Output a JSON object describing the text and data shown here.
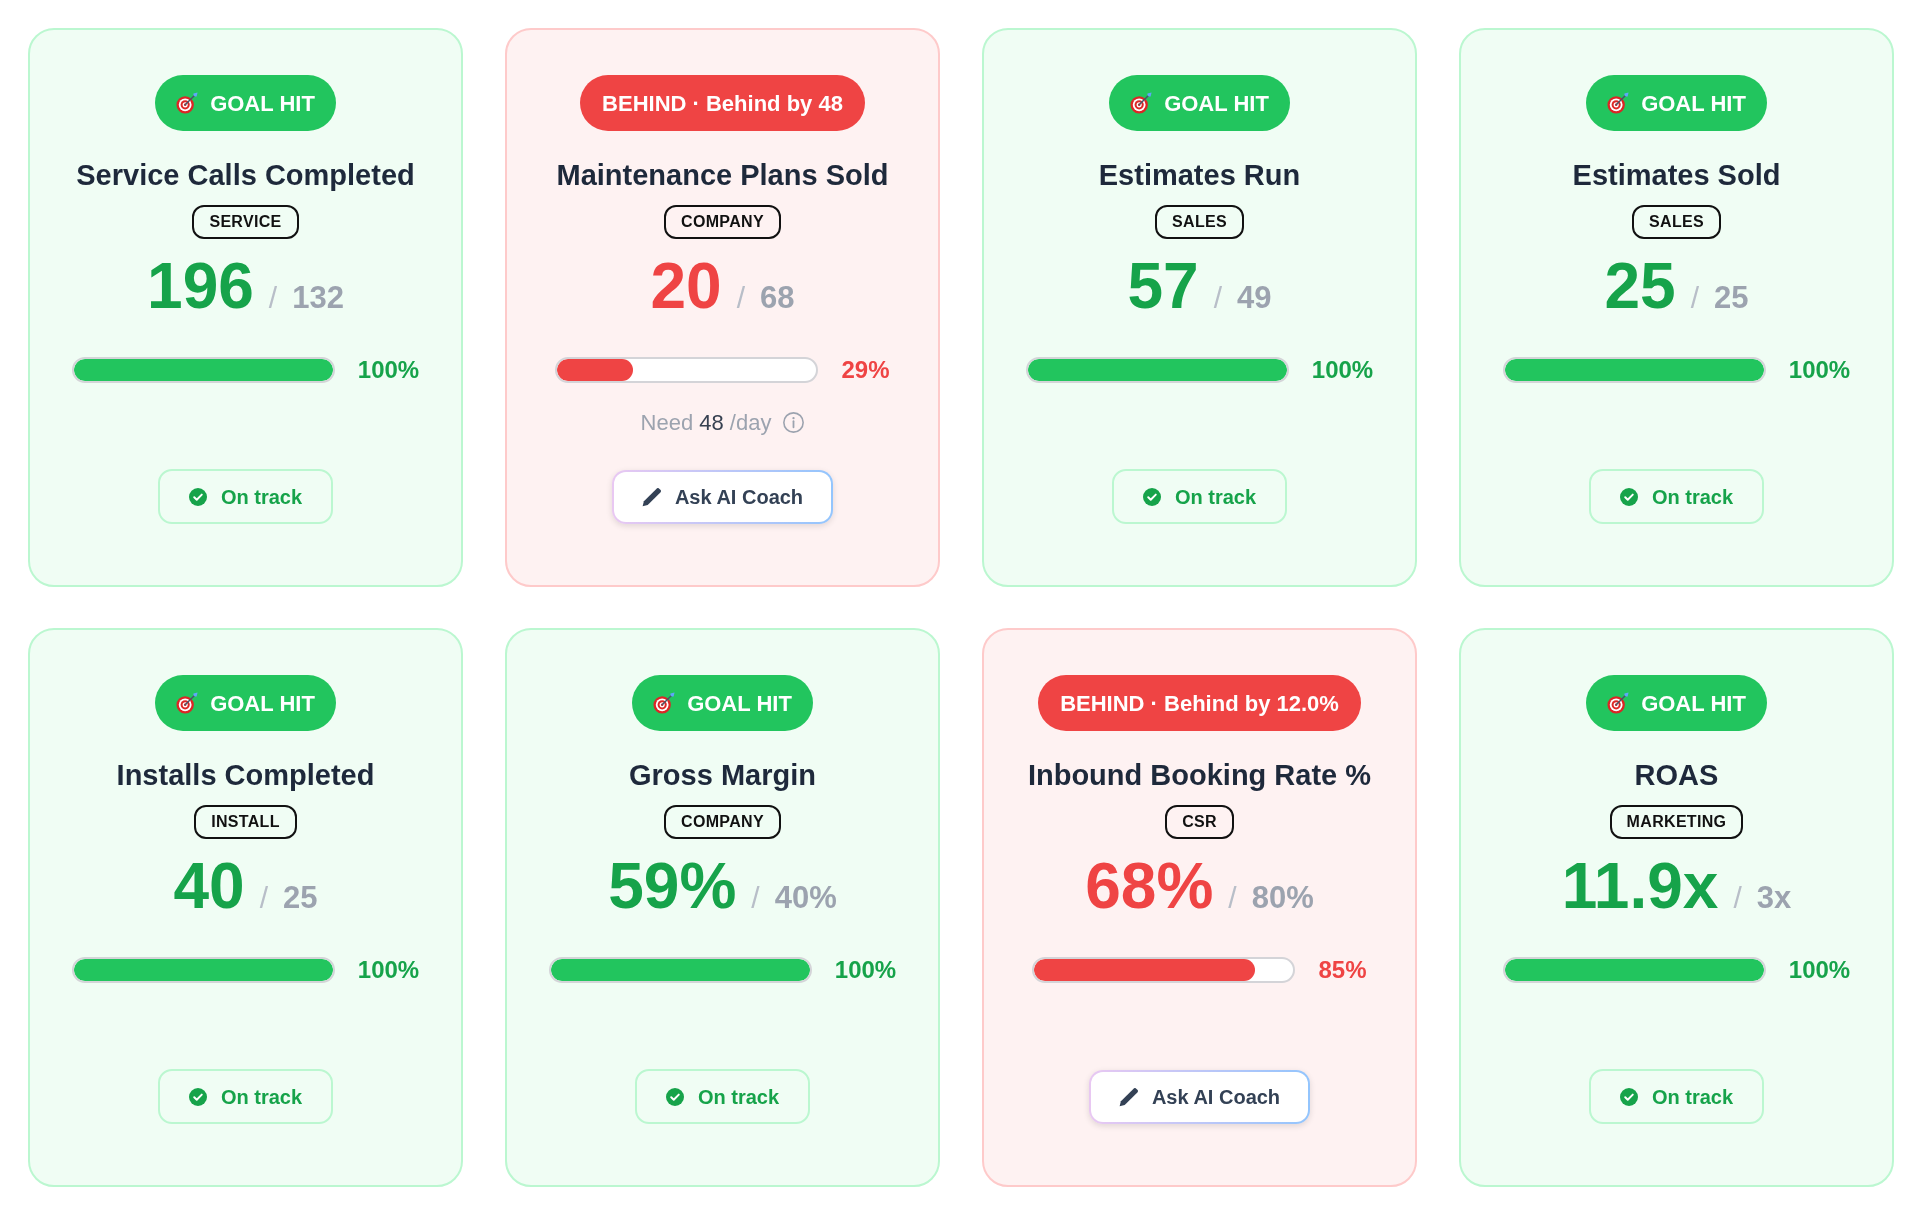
{
  "cards": [
    {
      "kind": "goal",
      "badge": "GOAL HIT",
      "title": "Service Calls Completed",
      "category": "SERVICE",
      "value": "196",
      "separator": "/",
      "target": "132",
      "level": 1.0,
      "percent": "100%",
      "action": {
        "kind": "status",
        "label": "On track"
      }
    },
    {
      "kind": "behind",
      "badge": "BEHIND · Behind by 48",
      "title": "Maintenance Plans Sold",
      "category": "COMPANY",
      "value": "20",
      "separator": "/",
      "target": "68",
      "level": 0.29,
      "percent": "29%",
      "pace": {
        "label": "Need",
        "amount": "48",
        "unit": "/day"
      },
      "action": {
        "kind": "coach",
        "label": "Ask AI Coach"
      }
    },
    {
      "kind": "goal",
      "badge": "GOAL HIT",
      "title": "Estimates Run",
      "category": "SALES",
      "value": "57",
      "separator": "/",
      "target": "49",
      "level": 1.0,
      "percent": "100%",
      "action": {
        "kind": "status",
        "label": "On track"
      }
    },
    {
      "kind": "goal",
      "badge": "GOAL HIT",
      "title": "Estimates Sold",
      "category": "SALES",
      "value": "25",
      "separator": "/",
      "target": "25",
      "level": 1.0,
      "percent": "100%",
      "action": {
        "kind": "status",
        "label": "On track"
      }
    },
    {
      "kind": "goal",
      "badge": "GOAL HIT",
      "title": "Installs Completed",
      "category": "INSTALL",
      "value": "40",
      "separator": "/",
      "target": "25",
      "level": 1.0,
      "percent": "100%",
      "action": {
        "kind": "status",
        "label": "On track"
      }
    },
    {
      "kind": "goal",
      "badge": "GOAL HIT",
      "title": "Gross Margin",
      "category": "COMPANY",
      "value": "59%",
      "separator": "/",
      "target": "40%",
      "level": 1.0,
      "percent": "100%",
      "action": {
        "kind": "status",
        "label": "On track"
      }
    },
    {
      "kind": "behind",
      "badge": "BEHIND · Behind by 12.0%",
      "title": "Inbound Booking Rate %",
      "category": "CSR",
      "value": "68%",
      "separator": "/",
      "target": "80%",
      "level": 0.85,
      "percent": "85%",
      "action": {
        "kind": "coach",
        "label": "Ask AI Coach"
      }
    },
    {
      "kind": "goal",
      "badge": "GOAL HIT",
      "title": "ROAS",
      "category": "MARKETING",
      "value": "11.9x",
      "separator": "/",
      "target": "3x",
      "level": 1.0,
      "percent": "100%",
      "action": {
        "kind": "status",
        "label": "On track"
      }
    }
  ]
}
